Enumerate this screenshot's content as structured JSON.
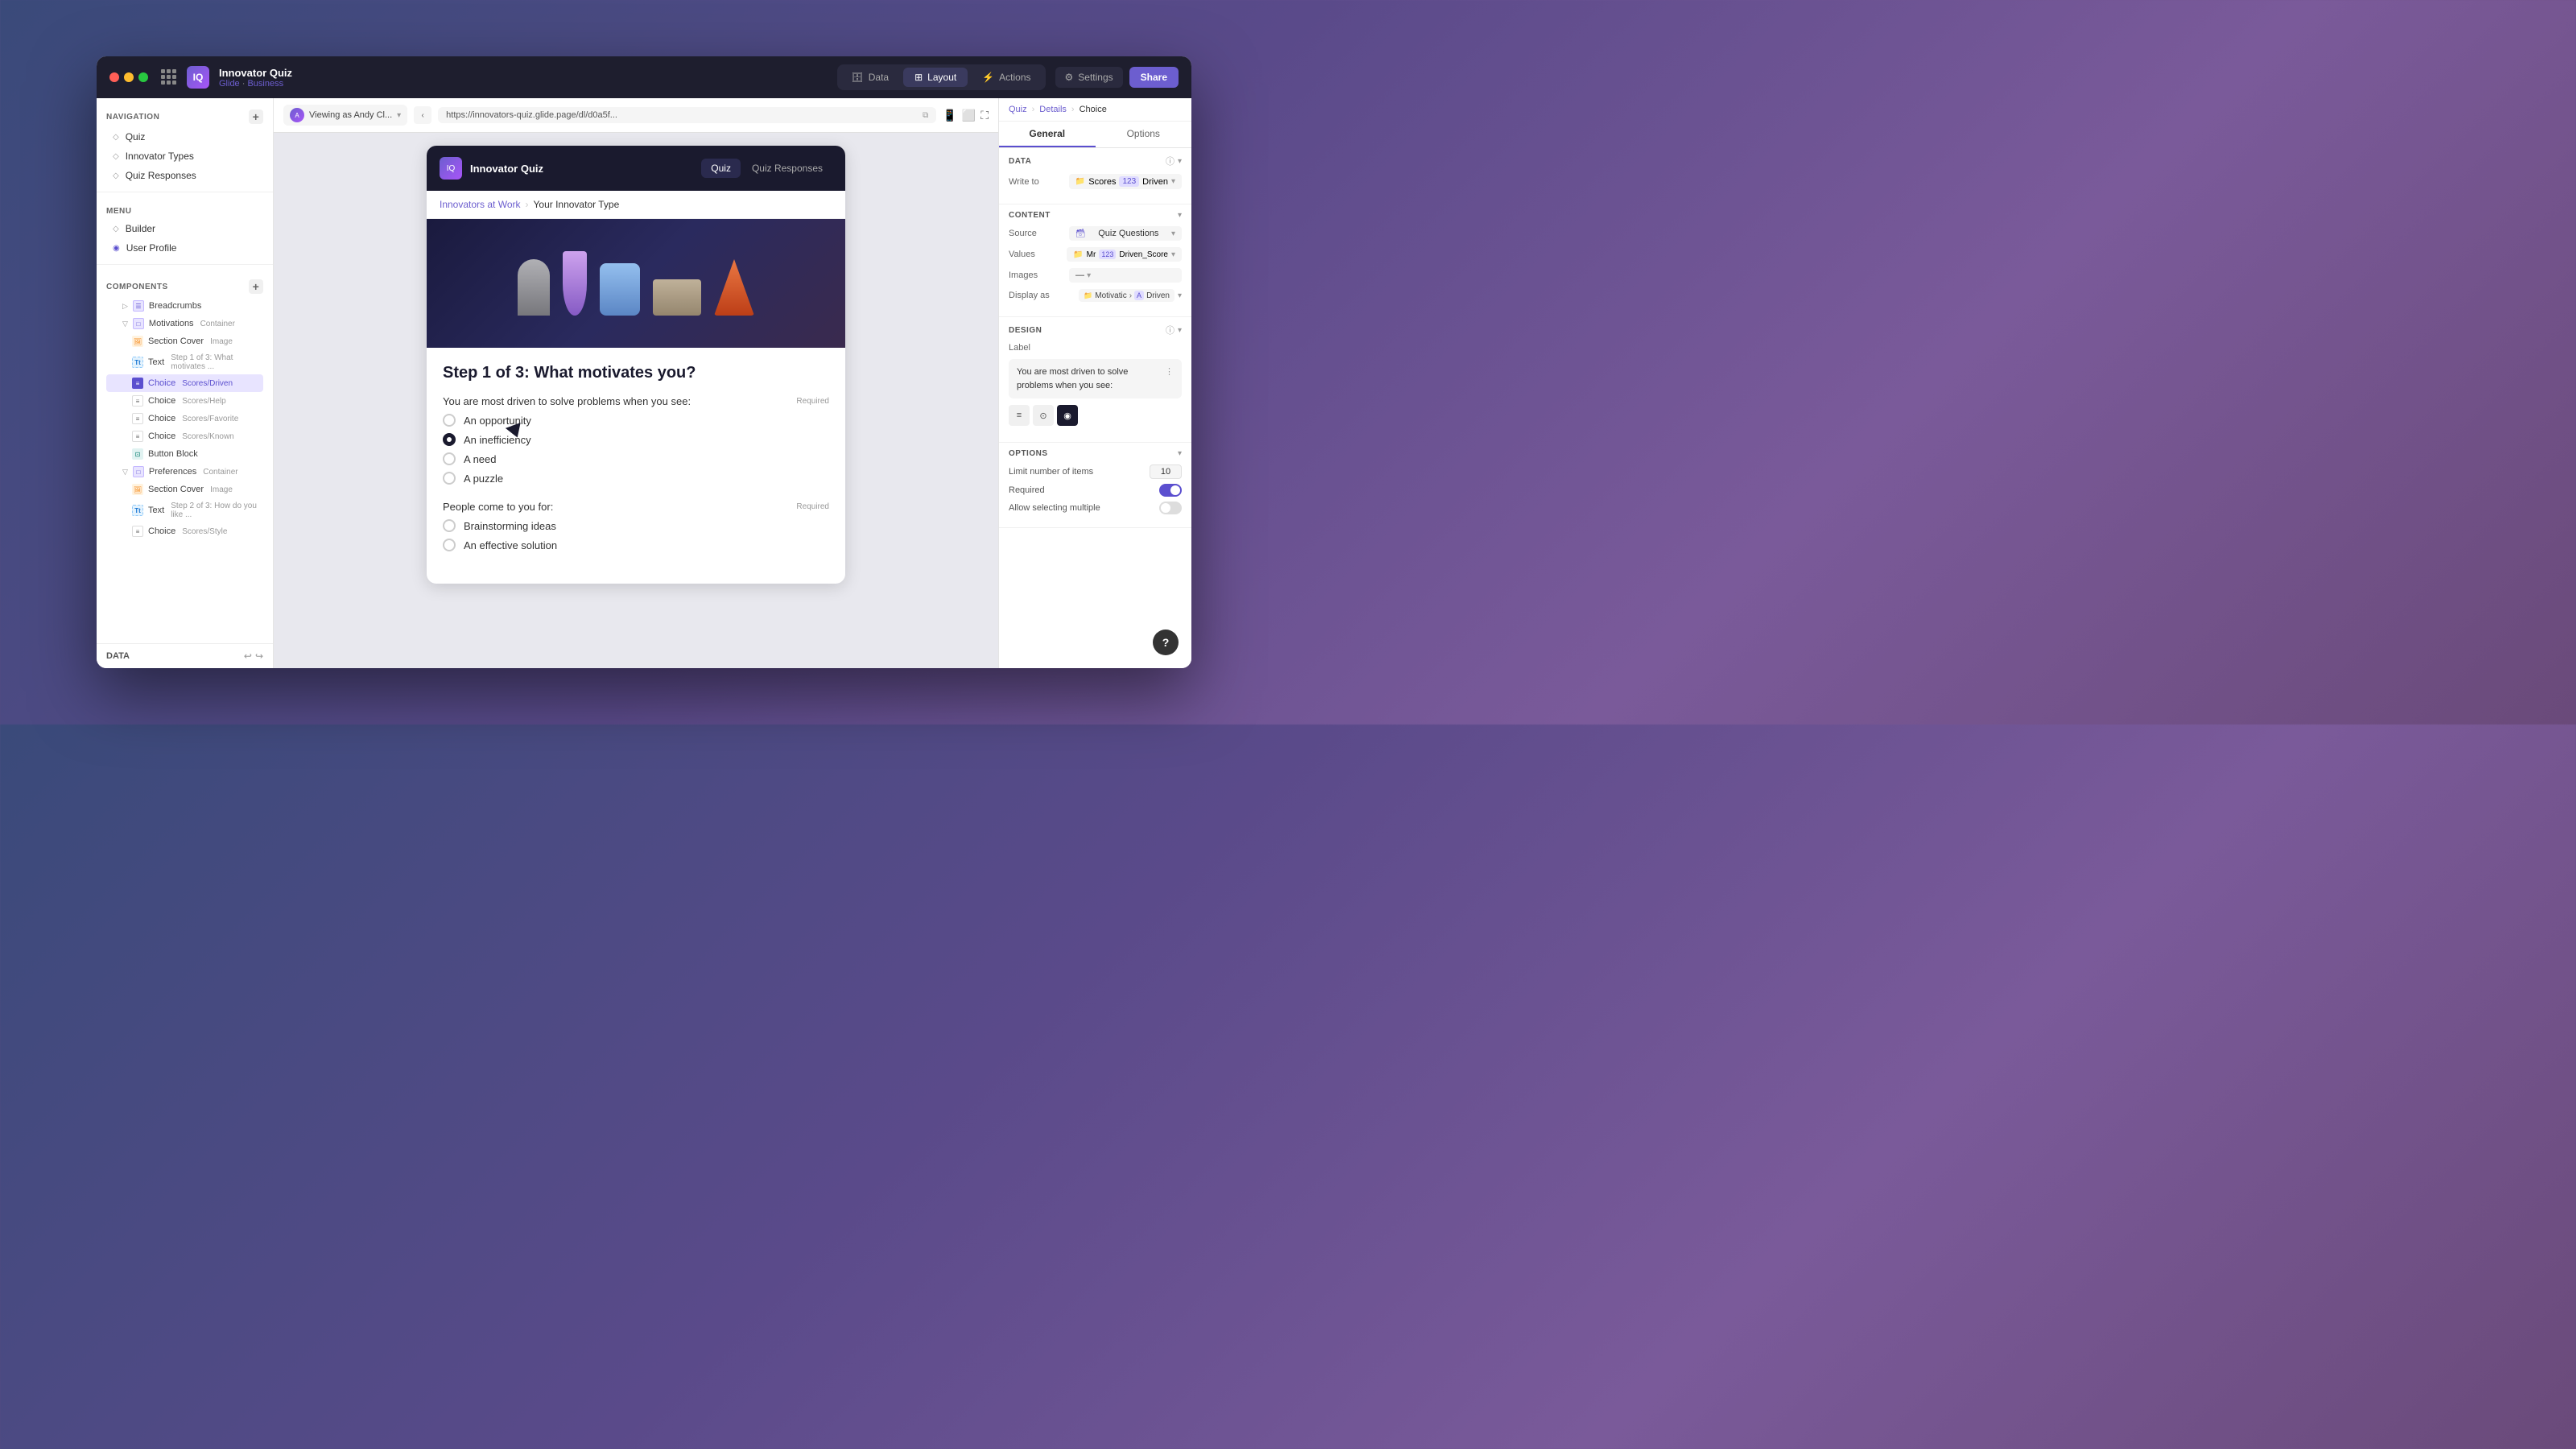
{
  "app": {
    "name": "Innovator Quiz",
    "glide_label": "Glide",
    "business_label": "Business"
  },
  "title_bar": {
    "nav_items": [
      {
        "id": "data",
        "label": "Data",
        "icon": "🗄"
      },
      {
        "id": "layout",
        "label": "Layout",
        "icon": "⊞"
      },
      {
        "id": "actions",
        "label": "Actions",
        "icon": "⚡"
      }
    ],
    "settings_label": "Settings",
    "share_label": "Share"
  },
  "left_nav": {
    "navigation_header": "NAVIGATION",
    "items": [
      {
        "label": "Quiz"
      },
      {
        "label": "Innovator Types"
      },
      {
        "label": "Quiz Responses"
      }
    ],
    "menu_header": "MENU",
    "menu_items": [
      {
        "label": "Builder"
      },
      {
        "label": "User Profile"
      }
    ]
  },
  "components": {
    "header": "COMPONENTS",
    "items": [
      {
        "indent": 0,
        "expand": true,
        "type": "crumb",
        "label": "Breadcrumbs",
        "sublabel": ""
      },
      {
        "indent": 0,
        "expand": true,
        "type": "container",
        "label": "Motivations",
        "sublabel": "Container"
      },
      {
        "indent": 1,
        "expand": false,
        "type": "image",
        "label": "Section Cover",
        "sublabel": "Image"
      },
      {
        "indent": 1,
        "expand": false,
        "type": "text",
        "label": "Text",
        "sublabel": "Step 1 of 3: What motivates ..."
      },
      {
        "indent": 1,
        "expand": false,
        "type": "choice-active",
        "label": "Choice",
        "sublabel": "Scores/Driven",
        "active": true
      },
      {
        "indent": 1,
        "expand": false,
        "type": "choice",
        "label": "Choice",
        "sublabel": "Scores/Help"
      },
      {
        "indent": 1,
        "expand": false,
        "type": "choice",
        "label": "Choice",
        "sublabel": "Scores/Favorite"
      },
      {
        "indent": 1,
        "expand": false,
        "type": "choice",
        "label": "Choice",
        "sublabel": "Scores/Known"
      },
      {
        "indent": 1,
        "expand": false,
        "type": "button",
        "label": "Button Block",
        "sublabel": ""
      },
      {
        "indent": 0,
        "expand": true,
        "type": "container",
        "label": "Preferences",
        "sublabel": "Container"
      },
      {
        "indent": 1,
        "expand": false,
        "type": "image",
        "label": "Section Cover",
        "sublabel": "Image"
      },
      {
        "indent": 1,
        "expand": false,
        "type": "text",
        "label": "Text",
        "sublabel": "Step 2 of 3: How do you like ..."
      },
      {
        "indent": 1,
        "expand": false,
        "type": "choice",
        "label": "Choice",
        "sublabel": "Scores/Style"
      }
    ]
  },
  "browser": {
    "viewer_label": "Viewing as Andy Cl...",
    "url": "https://innovators-quiz.glide.page/dl/d0a5f...",
    "devices": [
      "mobile",
      "tablet",
      "expand"
    ]
  },
  "quiz": {
    "title": "Innovator Quiz",
    "tabs": [
      {
        "label": "Quiz",
        "active": true
      },
      {
        "label": "Quiz Responses",
        "active": false
      }
    ],
    "breadcrumb": {
      "parent": "Innovators at Work",
      "current": "Your Innovator Type"
    },
    "step_title": "Step 1 of 3: What motivates you?",
    "question1": {
      "label": "You are most driven to solve problems when you see:",
      "required": "Required",
      "options": [
        {
          "label": "An opportunity",
          "selected": false
        },
        {
          "label": "An inefficiency",
          "selected": true
        },
        {
          "label": "A need",
          "selected": false
        },
        {
          "label": "A puzzle",
          "selected": false
        }
      ]
    },
    "question2": {
      "label": "People come to you for:",
      "required": "Required",
      "options": [
        {
          "label": "Brainstorming ideas",
          "selected": false
        },
        {
          "label": "An effective solution",
          "selected": false
        }
      ]
    }
  },
  "right_panel": {
    "breadcrumb": {
      "quiz": "Quiz",
      "details": "Details",
      "current": "Choice"
    },
    "tabs": [
      "General",
      "Options"
    ],
    "sections": {
      "data": {
        "title": "DATA",
        "write_to_label": "Write to",
        "scores_folder": "Scores",
        "scores_num": "123",
        "scores_driven": "Driven"
      },
      "content": {
        "title": "CONTENT",
        "source_label": "Source",
        "source_value": "Quiz Questions",
        "values_label": "Values",
        "folder": "Mr",
        "num": "123",
        "driven_score": "Driven_Score",
        "images_label": "Images",
        "images_value": "—",
        "display_label": "Display as",
        "display_folder": "Motivatic",
        "display_letter": "A",
        "display_text": "Driven"
      },
      "design": {
        "title": "DESIGN",
        "label_text": "You are most driven to solve problems when you see:",
        "style_icons": [
          "≡",
          "⊙",
          "◉"
        ],
        "active_style": 0
      },
      "options": {
        "title": "OPTIONS",
        "limit_label": "Limit number of items",
        "limit_value": "10",
        "required_label": "Required",
        "required_value": true,
        "multiple_label": "Allow selecting multiple",
        "multiple_value": false
      }
    }
  },
  "footer": {
    "data_label": "DATA"
  }
}
